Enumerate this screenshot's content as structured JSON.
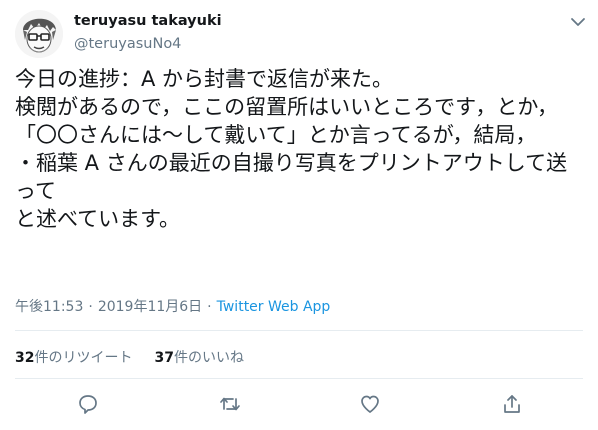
{
  "tweet": {
    "display_name": "teruyasu takayuki",
    "handle": "@teruyasuNo4",
    "text": "今日の進捗：A から封書で返信が来た。\n検閲があるので，ここの留置所はいいところです，とか，「〇〇さんには〜して戴いて」とか言ってるが，結局，\n・稲葉 A さんの最近の自撮り写真をプリントアウトして送って\nと述べています。",
    "time": "午後11:53",
    "separator": "·",
    "date": "2019年11月6日",
    "via": "Twitter Web App"
  },
  "stats": {
    "retweets_count": "32",
    "retweets_label": "件のリツイート",
    "likes_count": "37",
    "likes_label": "件のいいね"
  },
  "icons": {
    "avatar": "avatar-sketch",
    "menu": "chevron-down-icon",
    "reply": "reply-icon",
    "retweet": "retweet-icon",
    "like": "heart-icon",
    "share": "share-icon"
  },
  "colors": {
    "text": "#14171a",
    "secondary": "#657786",
    "link": "#1b95e0",
    "divider": "#e6ecf0"
  }
}
